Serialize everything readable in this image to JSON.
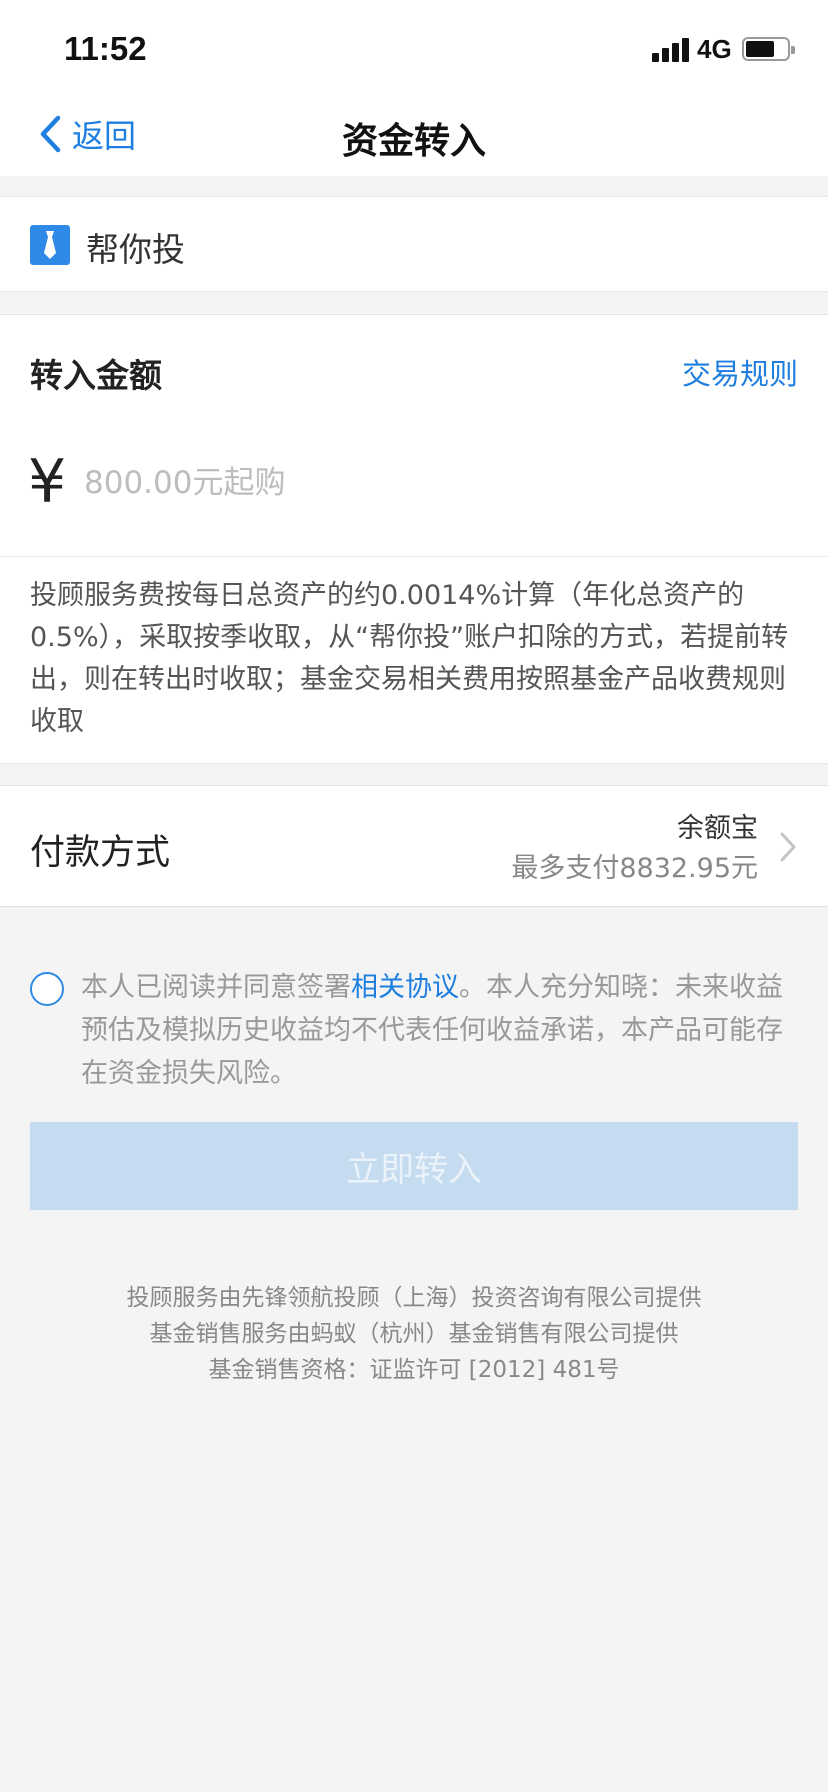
{
  "status_bar": {
    "time": "11:52",
    "network": "4G"
  },
  "nav": {
    "back_label": "返回",
    "title": "资金转入"
  },
  "product": {
    "name": "帮你投"
  },
  "amount": {
    "label": "转入金额",
    "rules_link": "交易规则",
    "currency_symbol": "¥",
    "placeholder": "800.00元起购",
    "fee_note": "投顾服务费按每日总资产的约0.0014%计算（年化总资产的0.5%），采取按季收取，从“帮你投”账户扣除的方式，若提前转出，则在转出时收取；基金交易相关费用按照基金产品收费规则收取"
  },
  "payment": {
    "label": "付款方式",
    "method": "余额宝",
    "limit": "最多支付8832.95元"
  },
  "agreement": {
    "prefix": "本人已阅读并同意签署",
    "link": "相关协议",
    "suffix": "。本人充分知晓：未来收益预估及模拟历史收益均不代表任何收益承诺，本产品可能存在资金损失风险。",
    "checked": false
  },
  "submit_label": "立即转入",
  "footer": {
    "line1": "投顾服务由先锋领航投顾（上海）投资咨询有限公司提供",
    "line2": "基金销售服务由蚂蚁（杭州）基金销售有限公司提供",
    "line3": "基金销售资格：证监许可 [2012] 481号"
  },
  "colors": {
    "accent": "#1f7fe0",
    "button_disabled": "#c5dbf0",
    "background": "#f4f4f4"
  }
}
